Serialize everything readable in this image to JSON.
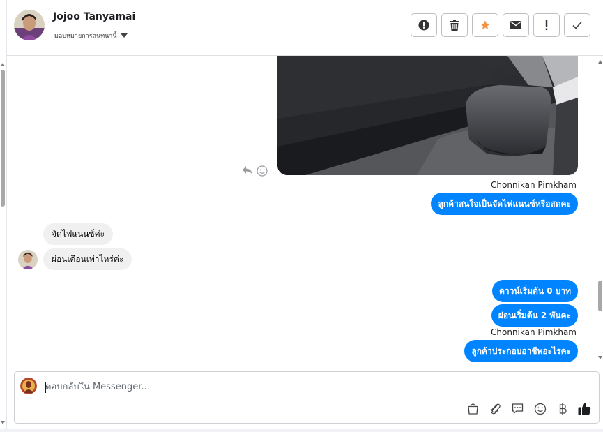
{
  "header": {
    "contact_name": "Jojoo Tanyamai",
    "assign_label": "มอบหมายการสนทนานี้",
    "actions": [
      {
        "icon": "alert-circle-icon"
      },
      {
        "icon": "trash-icon"
      },
      {
        "icon": "star-icon"
      },
      {
        "icon": "envelope-icon"
      },
      {
        "icon": "exclamation-icon"
      },
      {
        "icon": "check-icon"
      }
    ]
  },
  "messages": {
    "sender_1": "Chonnikan Pimkham",
    "out_1": "ลูกค้าสนใจเป็นจัดไฟแนนซ์หรือสดคะ",
    "in_1": "จัดไฟแนนซ์ค่ะ",
    "in_2": "ผ่อนเดือนเท่าไหร่ค่ะ",
    "out_2": "ดาวน์เริ่มต้น 0 บาท",
    "out_3": "ผ่อนเริ่มต้น 2 พันคะ",
    "sender_2": "Chonnikan Pimkham",
    "out_4": "ลูกค้าประกอบอาชีพอะไรคะ"
  },
  "composer": {
    "placeholder": "ตอบกลับใน Messenger...",
    "tools": [
      "shopping-bag-icon",
      "paperclip-icon",
      "saved-reply-icon",
      "emoji-icon",
      "baht-icon",
      "thumbs-up-icon"
    ]
  },
  "colors": {
    "outgoing_bubble": "#0084ff",
    "incoming_bubble": "#f0f0f0",
    "star": "#f5923e"
  }
}
